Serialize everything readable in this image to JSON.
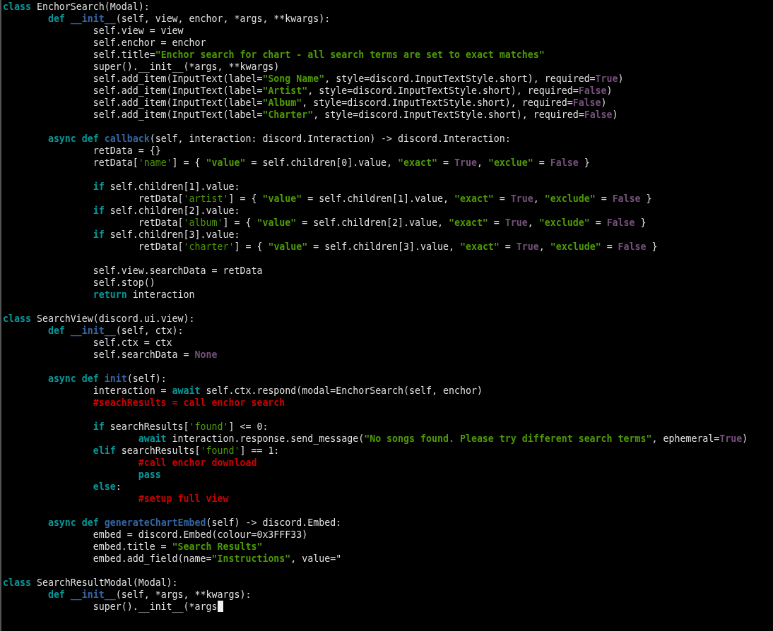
{
  "editor": {
    "lines": [
      {
        "kind": "code",
        "cursor": false,
        "tokens": [
          {
            "kind": "keyword",
            "text": "class"
          },
          {
            "kind": "plain",
            "text": " EnchorSearch(Modal):"
          }
        ]
      },
      {
        "kind": "code",
        "cursor": false,
        "tokens": [
          {
            "kind": "keyword",
            "text": "        def"
          },
          {
            "kind": "function",
            "text": " __init__"
          },
          {
            "kind": "plain",
            "text": "(self, view, enchor, *args, **kwargs):"
          }
        ]
      },
      {
        "kind": "code",
        "cursor": false,
        "tokens": [
          {
            "kind": "plain",
            "text": "                self.view = view"
          }
        ]
      },
      {
        "kind": "code",
        "cursor": false,
        "tokens": [
          {
            "kind": "plain",
            "text": "                self.enchor = enchor"
          }
        ]
      },
      {
        "kind": "code",
        "cursor": false,
        "tokens": [
          {
            "kind": "plain",
            "text": "                self.title="
          },
          {
            "kind": "string",
            "text": "\"Enchor search for chart - all search terms are set to exact matches\""
          }
        ]
      },
      {
        "kind": "code",
        "cursor": false,
        "tokens": [
          {
            "kind": "plain",
            "text": "                super().__init__(*args, **kwargs)"
          }
        ]
      },
      {
        "kind": "code",
        "cursor": false,
        "tokens": [
          {
            "kind": "plain",
            "text": "                self.add_item(InputText(label="
          },
          {
            "kind": "string",
            "text": "\"Song Name\""
          },
          {
            "kind": "plain",
            "text": ", style=discord.InputTextStyle.short), required="
          },
          {
            "kind": "constant",
            "text": "True"
          },
          {
            "kind": "plain",
            "text": ")"
          }
        ]
      },
      {
        "kind": "code",
        "cursor": false,
        "tokens": [
          {
            "kind": "plain",
            "text": "                self.add_item(InputText(label="
          },
          {
            "kind": "string",
            "text": "\"Artist\""
          },
          {
            "kind": "plain",
            "text": ", style=discord.InputTextStyle.short), required="
          },
          {
            "kind": "constant",
            "text": "False"
          },
          {
            "kind": "plain",
            "text": ")"
          }
        ]
      },
      {
        "kind": "code",
        "cursor": false,
        "tokens": [
          {
            "kind": "plain",
            "text": "                self.add_item(InputText(label="
          },
          {
            "kind": "string",
            "text": "\"Album\""
          },
          {
            "kind": "plain",
            "text": ", style=discord.InputTextStyle.short), required="
          },
          {
            "kind": "constant",
            "text": "False"
          },
          {
            "kind": "plain",
            "text": ")"
          }
        ]
      },
      {
        "kind": "code",
        "cursor": false,
        "tokens": [
          {
            "kind": "plain",
            "text": "                self.add_item(InputText(label="
          },
          {
            "kind": "string",
            "text": "\"Charter\""
          },
          {
            "kind": "plain",
            "text": ", style=discord.InputTextStyle.short), required="
          },
          {
            "kind": "constant",
            "text": "False"
          },
          {
            "kind": "plain",
            "text": ")"
          }
        ]
      },
      {
        "kind": "blank",
        "cursor": false
      },
      {
        "kind": "code",
        "cursor": false,
        "tokens": [
          {
            "kind": "keyword",
            "text": "        async def"
          },
          {
            "kind": "function",
            "text": " callback"
          },
          {
            "kind": "plain",
            "text": "(self, interaction: discord.Interaction) -> discord.Interaction:"
          }
        ]
      },
      {
        "kind": "code",
        "cursor": false,
        "tokens": [
          {
            "kind": "plain",
            "text": "                retData = {}"
          }
        ]
      },
      {
        "kind": "code",
        "cursor": false,
        "tokens": [
          {
            "kind": "plain",
            "text": "                retData["
          },
          {
            "kind": "key",
            "text": "'name'"
          },
          {
            "kind": "plain",
            "text": "] = { "
          },
          {
            "kind": "string",
            "text": "\"value\""
          },
          {
            "kind": "plain",
            "text": " = self.children[0].value, "
          },
          {
            "kind": "string",
            "text": "\"exact\""
          },
          {
            "kind": "plain",
            "text": " = "
          },
          {
            "kind": "constant",
            "text": "True"
          },
          {
            "kind": "plain",
            "text": ", "
          },
          {
            "kind": "string",
            "text": "\"exclue\""
          },
          {
            "kind": "plain",
            "text": " = "
          },
          {
            "kind": "constant",
            "text": "False"
          },
          {
            "kind": "plain",
            "text": " }"
          }
        ]
      },
      {
        "kind": "blank",
        "cursor": false
      },
      {
        "kind": "code",
        "cursor": false,
        "tokens": [
          {
            "kind": "keyword",
            "text": "                if"
          },
          {
            "kind": "plain",
            "text": " self.children[1].value:"
          }
        ]
      },
      {
        "kind": "code",
        "cursor": false,
        "tokens": [
          {
            "kind": "plain",
            "text": "                        retData["
          },
          {
            "kind": "key",
            "text": "'artist'"
          },
          {
            "kind": "plain",
            "text": "] = { "
          },
          {
            "kind": "string",
            "text": "\"value\""
          },
          {
            "kind": "plain",
            "text": " = self.children[1].value, "
          },
          {
            "kind": "string",
            "text": "\"exact\""
          },
          {
            "kind": "plain",
            "text": " = "
          },
          {
            "kind": "constant",
            "text": "True"
          },
          {
            "kind": "plain",
            "text": ", "
          },
          {
            "kind": "string",
            "text": "\"exclude\""
          },
          {
            "kind": "plain",
            "text": " = "
          },
          {
            "kind": "constant",
            "text": "False"
          },
          {
            "kind": "plain",
            "text": " }"
          }
        ]
      },
      {
        "kind": "code",
        "cursor": false,
        "tokens": [
          {
            "kind": "keyword",
            "text": "                if"
          },
          {
            "kind": "plain",
            "text": " self.children[2].value:"
          }
        ]
      },
      {
        "kind": "code",
        "cursor": false,
        "tokens": [
          {
            "kind": "plain",
            "text": "                        retData["
          },
          {
            "kind": "key",
            "text": "'album'"
          },
          {
            "kind": "plain",
            "text": "] = { "
          },
          {
            "kind": "string",
            "text": "\"value\""
          },
          {
            "kind": "plain",
            "text": " = self.children[2].value, "
          },
          {
            "kind": "string",
            "text": "\"exact\""
          },
          {
            "kind": "plain",
            "text": " = "
          },
          {
            "kind": "constant",
            "text": "True"
          },
          {
            "kind": "plain",
            "text": ", "
          },
          {
            "kind": "string",
            "text": "\"exclude\""
          },
          {
            "kind": "plain",
            "text": " = "
          },
          {
            "kind": "constant",
            "text": "False"
          },
          {
            "kind": "plain",
            "text": " }"
          }
        ]
      },
      {
        "kind": "code",
        "cursor": false,
        "tokens": [
          {
            "kind": "keyword",
            "text": "                if"
          },
          {
            "kind": "plain",
            "text": " self.children[3].value:"
          }
        ]
      },
      {
        "kind": "code",
        "cursor": false,
        "tokens": [
          {
            "kind": "plain",
            "text": "                        retData["
          },
          {
            "kind": "key",
            "text": "'charter'"
          },
          {
            "kind": "plain",
            "text": "] = { "
          },
          {
            "kind": "string",
            "text": "\"value\""
          },
          {
            "kind": "plain",
            "text": " = self.children[3].value, "
          },
          {
            "kind": "string",
            "text": "\"exact\""
          },
          {
            "kind": "plain",
            "text": " = "
          },
          {
            "kind": "constant",
            "text": "True"
          },
          {
            "kind": "plain",
            "text": ", "
          },
          {
            "kind": "string",
            "text": "\"exclude\""
          },
          {
            "kind": "plain",
            "text": " = "
          },
          {
            "kind": "constant",
            "text": "False"
          },
          {
            "kind": "plain",
            "text": " }"
          }
        ]
      },
      {
        "kind": "blank",
        "cursor": false
      },
      {
        "kind": "code",
        "cursor": false,
        "tokens": [
          {
            "kind": "plain",
            "text": "                self.view.searchData = retData"
          }
        ]
      },
      {
        "kind": "code",
        "cursor": false,
        "tokens": [
          {
            "kind": "plain",
            "text": "                self.stop()"
          }
        ]
      },
      {
        "kind": "code",
        "cursor": false,
        "tokens": [
          {
            "kind": "keyword",
            "text": "                return"
          },
          {
            "kind": "plain",
            "text": " interaction"
          }
        ]
      },
      {
        "kind": "blank",
        "cursor": false
      },
      {
        "kind": "code",
        "cursor": false,
        "tokens": [
          {
            "kind": "keyword",
            "text": "class"
          },
          {
            "kind": "plain",
            "text": " SearchView(discord.ui.view):"
          }
        ]
      },
      {
        "kind": "code",
        "cursor": false,
        "tokens": [
          {
            "kind": "keyword",
            "text": "        def"
          },
          {
            "kind": "function",
            "text": " __init__"
          },
          {
            "kind": "plain",
            "text": "(self, ctx):"
          }
        ]
      },
      {
        "kind": "code",
        "cursor": false,
        "tokens": [
          {
            "kind": "plain",
            "text": "                self.ctx = ctx"
          }
        ]
      },
      {
        "kind": "code",
        "cursor": false,
        "tokens": [
          {
            "kind": "plain",
            "text": "                self.searchData = "
          },
          {
            "kind": "constant",
            "text": "None"
          }
        ]
      },
      {
        "kind": "blank",
        "cursor": false
      },
      {
        "kind": "code",
        "cursor": false,
        "tokens": [
          {
            "kind": "keyword",
            "text": "        async def"
          },
          {
            "kind": "function",
            "text": " init"
          },
          {
            "kind": "plain",
            "text": "(self):"
          }
        ]
      },
      {
        "kind": "code",
        "cursor": false,
        "tokens": [
          {
            "kind": "plain",
            "text": "                interaction = "
          },
          {
            "kind": "keyword",
            "text": "await"
          },
          {
            "kind": "plain",
            "text": " self.ctx.respond(modal=EnchorSearch(self, enchor)"
          }
        ]
      },
      {
        "kind": "code",
        "cursor": false,
        "tokens": [
          {
            "kind": "comment",
            "text": "                #seachResults = call enchor search"
          }
        ]
      },
      {
        "kind": "blank",
        "cursor": false
      },
      {
        "kind": "code",
        "cursor": false,
        "tokens": [
          {
            "kind": "keyword",
            "text": "                if"
          },
          {
            "kind": "plain",
            "text": " searchResults["
          },
          {
            "kind": "key",
            "text": "'found'"
          },
          {
            "kind": "plain",
            "text": "] <= 0:"
          }
        ]
      },
      {
        "kind": "code",
        "cursor": false,
        "tokens": [
          {
            "kind": "keyword",
            "text": "                        await"
          },
          {
            "kind": "plain",
            "text": " interaction.response.send_message("
          },
          {
            "kind": "string",
            "text": "\"No songs found. Please try different search terms\""
          },
          {
            "kind": "plain",
            "text": ", ephemeral="
          },
          {
            "kind": "constant",
            "text": "True"
          },
          {
            "kind": "plain",
            "text": ")"
          }
        ]
      },
      {
        "kind": "code",
        "cursor": false,
        "tokens": [
          {
            "kind": "keyword",
            "text": "                elif"
          },
          {
            "kind": "plain",
            "text": " searchResults["
          },
          {
            "kind": "key",
            "text": "'found'"
          },
          {
            "kind": "plain",
            "text": "] == 1:"
          }
        ]
      },
      {
        "kind": "code",
        "cursor": false,
        "tokens": [
          {
            "kind": "comment",
            "text": "                        #call enchor download"
          }
        ]
      },
      {
        "kind": "code",
        "cursor": false,
        "tokens": [
          {
            "kind": "keyword",
            "text": "                        pass"
          }
        ]
      },
      {
        "kind": "code",
        "cursor": false,
        "tokens": [
          {
            "kind": "keyword",
            "text": "                else"
          },
          {
            "kind": "plain",
            "text": ":"
          }
        ]
      },
      {
        "kind": "code",
        "cursor": false,
        "tokens": [
          {
            "kind": "comment",
            "text": "                        #setup full view"
          }
        ]
      },
      {
        "kind": "blank",
        "cursor": false
      },
      {
        "kind": "code",
        "cursor": false,
        "tokens": [
          {
            "kind": "keyword",
            "text": "        async def"
          },
          {
            "kind": "function",
            "text": " generateChartEmbed"
          },
          {
            "kind": "plain",
            "text": "(self) -> discord.Embed:"
          }
        ]
      },
      {
        "kind": "code",
        "cursor": false,
        "tokens": [
          {
            "kind": "plain",
            "text": "                embed = discord.Embed(colour=0x3FFF33)"
          }
        ]
      },
      {
        "kind": "code",
        "cursor": false,
        "tokens": [
          {
            "kind": "plain",
            "text": "                embed.title = "
          },
          {
            "kind": "string",
            "text": "\"Search Results\""
          }
        ]
      },
      {
        "kind": "code",
        "cursor": false,
        "tokens": [
          {
            "kind": "plain",
            "text": "                embed.add_field(name="
          },
          {
            "kind": "string",
            "text": "\"Instructions\""
          },
          {
            "kind": "plain",
            "text": ", value=\""
          }
        ]
      },
      {
        "kind": "blank",
        "cursor": false
      },
      {
        "kind": "code",
        "cursor": false,
        "tokens": [
          {
            "kind": "keyword",
            "text": "class"
          },
          {
            "kind": "plain",
            "text": " SearchResultModal(Modal):"
          }
        ]
      },
      {
        "kind": "code",
        "cursor": false,
        "tokens": [
          {
            "kind": "keyword",
            "text": "        def"
          },
          {
            "kind": "function",
            "text": " __init__"
          },
          {
            "kind": "plain",
            "text": "(self, *args, **kwargs):"
          }
        ]
      },
      {
        "kind": "code",
        "cursor": true,
        "tokens": [
          {
            "kind": "plain",
            "text": "                super().__init__(*args"
          }
        ]
      }
    ]
  }
}
